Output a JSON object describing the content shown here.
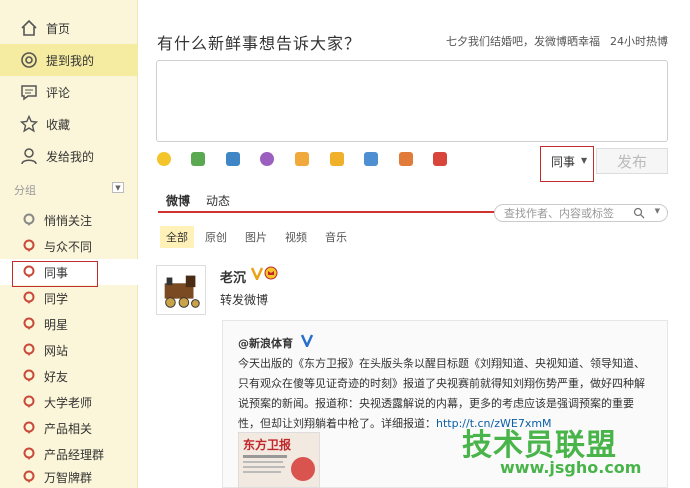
{
  "sidebar": {
    "nav": [
      {
        "label": "首页",
        "icon": "home-icon"
      },
      {
        "label": "提到我的",
        "icon": "at-icon"
      },
      {
        "label": "评论",
        "icon": "comment-icon"
      },
      {
        "label": "收藏",
        "icon": "star-icon"
      },
      {
        "label": "发给我的",
        "icon": "user-icon"
      }
    ],
    "section_label": "分组",
    "groups": [
      "悄悄关注",
      "与众不同",
      "同事",
      "同学",
      "明星",
      "网站",
      "好友",
      "大学老师",
      "产品相关",
      "产品经理群",
      "万智牌群"
    ]
  },
  "composer": {
    "prompt": "有什么新鲜事想告诉大家？",
    "trend_text": "七夕我们结婚吧，发微博晒幸福",
    "trend_hot": "24小时热博",
    "group_select": "同事",
    "publish": "发布",
    "toolbar_icons": [
      "emoji-icon",
      "image-icon",
      "video-icon",
      "music-icon",
      "topic-icon",
      "like-icon",
      "vote-icon",
      "chart-icon",
      "app-icon",
      "more-icon"
    ]
  },
  "feed_tabs": {
    "items": [
      "微博",
      "动态"
    ],
    "search_placeholder": "查找作者、内容或标签"
  },
  "filters": [
    "全部",
    "原创",
    "图片",
    "视频",
    "音乐"
  ],
  "post": {
    "author": "老沉",
    "text": "转发微博",
    "quote": {
      "author": "@新浪体育",
      "lines": [
        "今天出版的《东方卫报》在头版头条以醒目标题《刘翔知道、央视知道、领导知道、",
        "只有观众在傻等见证奇迹的时刻》报道了央视赛前就得知刘翔伤势严重，做好四种解",
        "说预案的新闻。报道称：央视透露解说的内幕，更多的考虑应该是强调预案的重要",
        "性，但却让刘翔躺着中枪了。详细报道："
      ],
      "link": "http://t.cn/zWE7xmM",
      "thumb_title": "东方卫报"
    }
  },
  "watermark": {
    "text": "技术员联盟",
    "url": "www.jsgho.com"
  },
  "colors": {
    "sidebar_bg": "#fbf6d9",
    "accent_red": "#d3332f",
    "link_blue": "#0a5fa8",
    "watermark_green": "#49b44a"
  }
}
